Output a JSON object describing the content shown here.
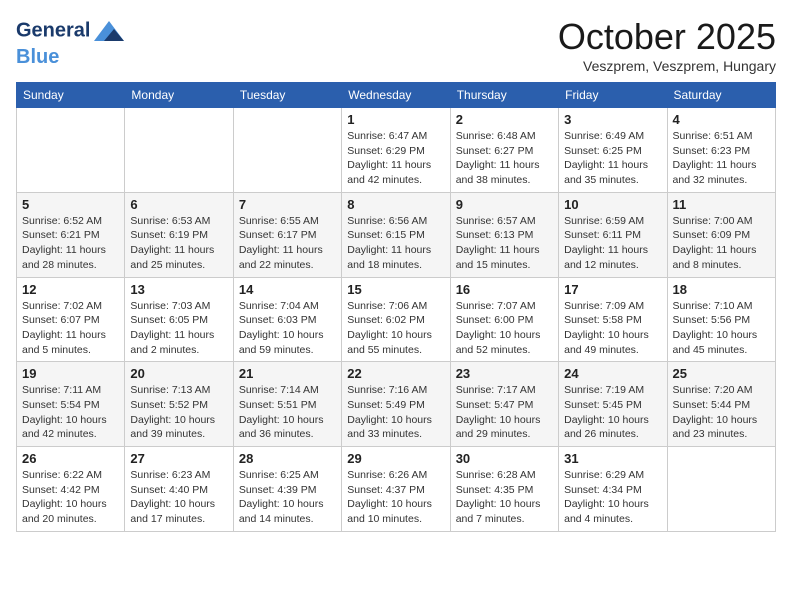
{
  "header": {
    "logo_line1": "General",
    "logo_line2": "Blue",
    "month_title": "October 2025",
    "location": "Veszprem, Veszprem, Hungary"
  },
  "weekdays": [
    "Sunday",
    "Monday",
    "Tuesday",
    "Wednesday",
    "Thursday",
    "Friday",
    "Saturday"
  ],
  "weeks": [
    [
      {
        "day": "",
        "info": ""
      },
      {
        "day": "",
        "info": ""
      },
      {
        "day": "",
        "info": ""
      },
      {
        "day": "1",
        "info": "Sunrise: 6:47 AM\nSunset: 6:29 PM\nDaylight: 11 hours\nand 42 minutes."
      },
      {
        "day": "2",
        "info": "Sunrise: 6:48 AM\nSunset: 6:27 PM\nDaylight: 11 hours\nand 38 minutes."
      },
      {
        "day": "3",
        "info": "Sunrise: 6:49 AM\nSunset: 6:25 PM\nDaylight: 11 hours\nand 35 minutes."
      },
      {
        "day": "4",
        "info": "Sunrise: 6:51 AM\nSunset: 6:23 PM\nDaylight: 11 hours\nand 32 minutes."
      }
    ],
    [
      {
        "day": "5",
        "info": "Sunrise: 6:52 AM\nSunset: 6:21 PM\nDaylight: 11 hours\nand 28 minutes."
      },
      {
        "day": "6",
        "info": "Sunrise: 6:53 AM\nSunset: 6:19 PM\nDaylight: 11 hours\nand 25 minutes."
      },
      {
        "day": "7",
        "info": "Sunrise: 6:55 AM\nSunset: 6:17 PM\nDaylight: 11 hours\nand 22 minutes."
      },
      {
        "day": "8",
        "info": "Sunrise: 6:56 AM\nSunset: 6:15 PM\nDaylight: 11 hours\nand 18 minutes."
      },
      {
        "day": "9",
        "info": "Sunrise: 6:57 AM\nSunset: 6:13 PM\nDaylight: 11 hours\nand 15 minutes."
      },
      {
        "day": "10",
        "info": "Sunrise: 6:59 AM\nSunset: 6:11 PM\nDaylight: 11 hours\nand 12 minutes."
      },
      {
        "day": "11",
        "info": "Sunrise: 7:00 AM\nSunset: 6:09 PM\nDaylight: 11 hours\nand 8 minutes."
      }
    ],
    [
      {
        "day": "12",
        "info": "Sunrise: 7:02 AM\nSunset: 6:07 PM\nDaylight: 11 hours\nand 5 minutes."
      },
      {
        "day": "13",
        "info": "Sunrise: 7:03 AM\nSunset: 6:05 PM\nDaylight: 11 hours\nand 2 minutes."
      },
      {
        "day": "14",
        "info": "Sunrise: 7:04 AM\nSunset: 6:03 PM\nDaylight: 10 hours\nand 59 minutes."
      },
      {
        "day": "15",
        "info": "Sunrise: 7:06 AM\nSunset: 6:02 PM\nDaylight: 10 hours\nand 55 minutes."
      },
      {
        "day": "16",
        "info": "Sunrise: 7:07 AM\nSunset: 6:00 PM\nDaylight: 10 hours\nand 52 minutes."
      },
      {
        "day": "17",
        "info": "Sunrise: 7:09 AM\nSunset: 5:58 PM\nDaylight: 10 hours\nand 49 minutes."
      },
      {
        "day": "18",
        "info": "Sunrise: 7:10 AM\nSunset: 5:56 PM\nDaylight: 10 hours\nand 45 minutes."
      }
    ],
    [
      {
        "day": "19",
        "info": "Sunrise: 7:11 AM\nSunset: 5:54 PM\nDaylight: 10 hours\nand 42 minutes."
      },
      {
        "day": "20",
        "info": "Sunrise: 7:13 AM\nSunset: 5:52 PM\nDaylight: 10 hours\nand 39 minutes."
      },
      {
        "day": "21",
        "info": "Sunrise: 7:14 AM\nSunset: 5:51 PM\nDaylight: 10 hours\nand 36 minutes."
      },
      {
        "day": "22",
        "info": "Sunrise: 7:16 AM\nSunset: 5:49 PM\nDaylight: 10 hours\nand 33 minutes."
      },
      {
        "day": "23",
        "info": "Sunrise: 7:17 AM\nSunset: 5:47 PM\nDaylight: 10 hours\nand 29 minutes."
      },
      {
        "day": "24",
        "info": "Sunrise: 7:19 AM\nSunset: 5:45 PM\nDaylight: 10 hours\nand 26 minutes."
      },
      {
        "day": "25",
        "info": "Sunrise: 7:20 AM\nSunset: 5:44 PM\nDaylight: 10 hours\nand 23 minutes."
      }
    ],
    [
      {
        "day": "26",
        "info": "Sunrise: 6:22 AM\nSunset: 4:42 PM\nDaylight: 10 hours\nand 20 minutes."
      },
      {
        "day": "27",
        "info": "Sunrise: 6:23 AM\nSunset: 4:40 PM\nDaylight: 10 hours\nand 17 minutes."
      },
      {
        "day": "28",
        "info": "Sunrise: 6:25 AM\nSunset: 4:39 PM\nDaylight: 10 hours\nand 14 minutes."
      },
      {
        "day": "29",
        "info": "Sunrise: 6:26 AM\nSunset: 4:37 PM\nDaylight: 10 hours\nand 10 minutes."
      },
      {
        "day": "30",
        "info": "Sunrise: 6:28 AM\nSunset: 4:35 PM\nDaylight: 10 hours\nand 7 minutes."
      },
      {
        "day": "31",
        "info": "Sunrise: 6:29 AM\nSunset: 4:34 PM\nDaylight: 10 hours\nand 4 minutes."
      },
      {
        "day": "",
        "info": ""
      }
    ]
  ]
}
